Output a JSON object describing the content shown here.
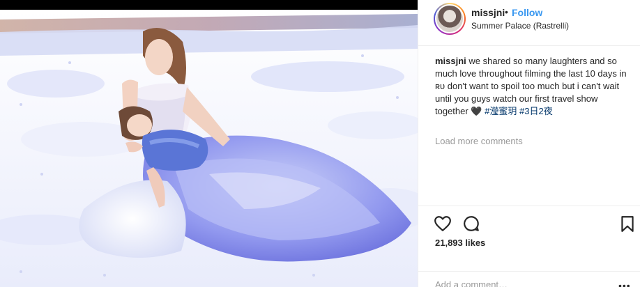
{
  "post": {
    "username": "missjni",
    "separator": "•",
    "follow_label": "Follow",
    "location": "Summer Palace (Rastrelli)"
  },
  "caption": {
    "username": "missjni",
    "text": "we shared so many laughters and so much love throughout filming the last 10 days in ʀᴜ don't want to spoil too much but i can't wait until you guys watch our first travel show together 🖤",
    "hashtag1": "#瀅蜜玥",
    "hashtag2": "#3日2夜"
  },
  "comments": {
    "load_more_label": "Load more comments"
  },
  "actions": {
    "like_icon": "heart-icon",
    "comment_icon": "comment-bubble-icon",
    "save_icon": "bookmark-icon"
  },
  "likes": {
    "text": "21,893 likes"
  },
  "add_comment": {
    "placeholder": "Add a comment…",
    "more_icon": "more-icon"
  },
  "colors": {
    "link_blue": "#3897f0",
    "hashtag_blue": "#003569",
    "muted_gray": "#999999",
    "text": "#262626"
  }
}
